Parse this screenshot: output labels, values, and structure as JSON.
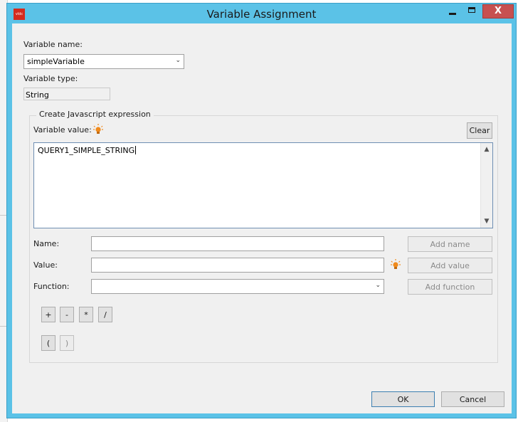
{
  "window": {
    "title": "Variable Assignment",
    "app_icon_text": "vldc",
    "minimize_icon": "minimize-icon",
    "maximize_icon": "maximize-icon",
    "close_label": "X"
  },
  "form": {
    "variable_name_label": "Variable name:",
    "variable_name_value": "simpleVariable",
    "variable_type_label": "Variable type:",
    "variable_type_value": "String"
  },
  "expression": {
    "group_title": "Create Javascript expression",
    "value_label": "Variable value:",
    "clear_label": "Clear",
    "text": "QUERY1_SIMPLE_STRING",
    "scroll_up": "▲",
    "scroll_down": "▼"
  },
  "builder": {
    "name_label": "Name:",
    "value_label": "Value:",
    "function_label": "Function:",
    "name_value": "",
    "value_value": "",
    "function_value": "",
    "add_name_label": "Add name",
    "add_value_label": "Add value",
    "add_function_label": "Add function",
    "operators": [
      "+",
      "-",
      "*",
      "/"
    ],
    "parens": [
      "(",
      ")"
    ]
  },
  "footer": {
    "ok_label": "OK",
    "cancel_label": "Cancel"
  },
  "colors": {
    "titlebar": "#5bc2e7",
    "close_button": "#c75050",
    "dialog_bg": "#f0f0f0",
    "bulb": "#f08a1c"
  }
}
